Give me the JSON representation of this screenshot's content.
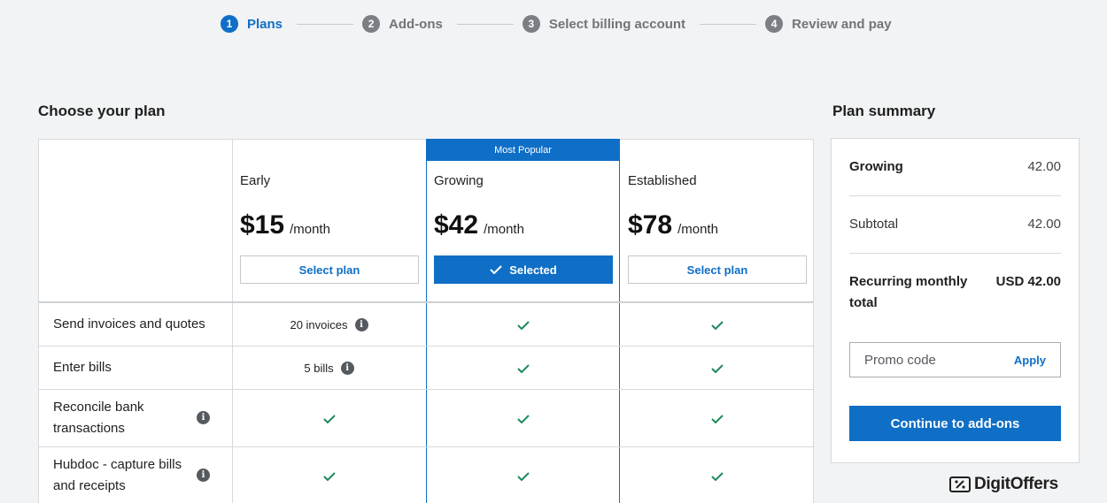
{
  "stepper": {
    "steps": [
      {
        "num": "1",
        "label": "Plans"
      },
      {
        "num": "2",
        "label": "Add-ons"
      },
      {
        "num": "3",
        "label": "Select billing account"
      },
      {
        "num": "4",
        "label": "Review and pay"
      }
    ],
    "active_step": 1
  },
  "plans_section": {
    "title": "Choose your plan",
    "popular_label": "Most Popular",
    "plans": [
      {
        "name": "Early",
        "price": "$15",
        "period": "/month",
        "button": "Select plan",
        "selected": false
      },
      {
        "name": "Growing",
        "price": "$42",
        "period": "/month",
        "button": "Selected",
        "selected": true
      },
      {
        "name": "Established",
        "price": "$78",
        "period": "/month",
        "button": "Select plan",
        "selected": false
      }
    ],
    "features": [
      {
        "label": "Send invoices and quotes",
        "has_info": false,
        "early": "20 invoices",
        "early_info": true,
        "growing": "check",
        "established": "check"
      },
      {
        "label": "Enter bills",
        "has_info": false,
        "early": "5 bills",
        "early_info": true,
        "growing": "check",
        "established": "check"
      },
      {
        "label": "Reconcile bank transactions",
        "has_info": true,
        "early": "check",
        "early_info": false,
        "growing": "check",
        "established": "check"
      },
      {
        "label": "Hubdoc - capture bills and receipts",
        "has_info": true,
        "early": "check",
        "early_info": false,
        "growing": "check",
        "established": "check"
      }
    ]
  },
  "summary": {
    "title": "Plan summary",
    "plan_name": "Growing",
    "plan_amount": "42.00",
    "subtotal_label": "Subtotal",
    "subtotal_amount": "42.00",
    "total_label": "Recurring monthly total",
    "total_amount": "USD 42.00",
    "promo_placeholder": "Promo code",
    "apply_label": "Apply",
    "continue_label": "Continue to add-ons"
  },
  "brand": {
    "name": "DigitOffers"
  },
  "colors": {
    "accent": "#0f6fc6",
    "check": "#1f8a5b",
    "inactive_step": "#7b7f84"
  }
}
